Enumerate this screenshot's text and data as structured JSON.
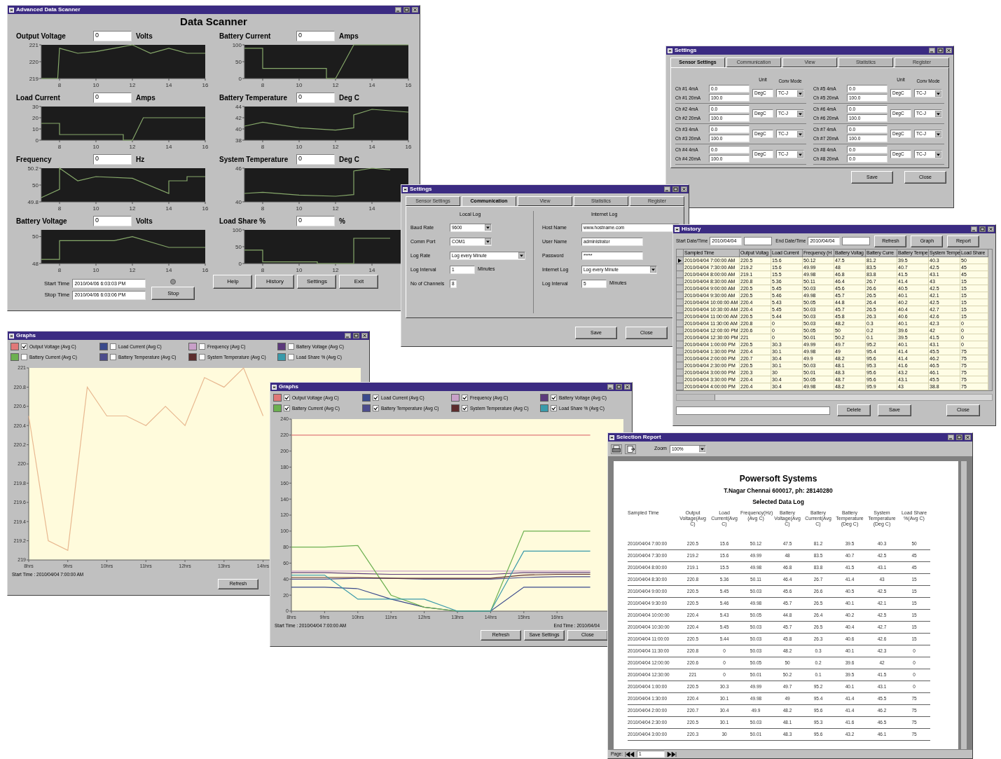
{
  "windows": [
    {
      "kind": "scanner",
      "title": "Advanced Data Scanner",
      "heading": "Data Scanner",
      "panels": [
        {
          "label": "Output Voltage",
          "value": "0",
          "unit": "Volts",
          "chart_data": {
            "type": "line",
            "x": [
              7,
              7.9,
              8,
              9,
              10,
              11,
              12,
              13,
              14,
              15,
              16
            ],
            "xlim": [
              7,
              16
            ],
            "ylim": [
              219,
              221
            ],
            "xticks": [
              8,
              10,
              12,
              14,
              16
            ],
            "yticks": [
              219,
              220,
              221
            ],
            "series": [
              {
                "color": "#86a86a",
                "values": [
                  219,
                  219,
                  220.8,
                  220.5,
                  220.6,
                  220.8,
                  221,
                  220.5,
                  220.8,
                  220.5,
                  220.5
                ]
              }
            ]
          }
        },
        {
          "label": "Battery Current",
          "value": "0",
          "unit": "Amps",
          "chart_data": {
            "type": "line",
            "x": [
              7,
              8,
              8,
              11.5,
              11.5,
              12,
              13,
              16
            ],
            "xlim": [
              7,
              16
            ],
            "ylim": [
              0,
              100
            ],
            "xticks": [
              8,
              10,
              12,
              14,
              16
            ],
            "yticks": [
              0,
              50,
              100
            ],
            "series": [
              {
                "color": "#86a86a",
                "values": [
                  90,
                  90,
                  30,
                  30,
                  0,
                  0,
                  100,
                  100
                ]
              }
            ]
          }
        },
        {
          "label": "Load Current",
          "value": "0",
          "unit": "Amps",
          "chart_data": {
            "type": "line",
            "x": [
              7,
              8,
              8,
              11.5,
              11.5,
              12,
              12.6,
              16
            ],
            "xlim": [
              7,
              16
            ],
            "ylim": [
              0,
              30
            ],
            "xticks": [
              8,
              10,
              12,
              14,
              16
            ],
            "yticks": [
              0,
              10,
              20,
              30
            ],
            "series": [
              {
                "color": "#86a86a",
                "values": [
                  15,
                  15,
                  5,
                  5,
                  0,
                  0,
                  20,
                  20
                ]
              }
            ]
          }
        },
        {
          "label": "Battery Temperature",
          "value": "0",
          "unit": "Deg C",
          "chart_data": {
            "type": "line",
            "x": [
              7,
              8,
              10,
              12,
              13,
              13,
              14,
              16
            ],
            "xlim": [
              7,
              16
            ],
            "ylim": [
              38,
              44
            ],
            "xticks": [
              8,
              10,
              12,
              14,
              16
            ],
            "yticks": [
              38,
              40,
              42,
              44
            ],
            "series": [
              {
                "color": "#86a86a",
                "values": [
                  40.5,
                  41.2,
                  40.2,
                  39.8,
                  40.2,
                  42.5,
                  43.5,
                  43
                ]
              }
            ]
          }
        },
        {
          "label": "Frequency",
          "value": "0",
          "unit": "Hz",
          "chart_data": {
            "type": "line",
            "x": [
              7,
              8,
              8,
              9,
              10,
              12,
              14,
              14,
              15,
              15,
              16
            ],
            "xlim": [
              7,
              16
            ],
            "ylim": [
              49.8,
              50.2
            ],
            "xticks": [
              8,
              10,
              12,
              14,
              16
            ],
            "yticks": [
              49.8,
              50,
              50.2
            ],
            "series": [
              {
                "color": "#86a86a",
                "values": [
                  49.85,
                  49.95,
                  50.2,
                  50.05,
                  50.1,
                  50.08,
                  49.9,
                  50.05,
                  50.05,
                  50.1,
                  50.1
                ]
              }
            ]
          }
        },
        {
          "label": "System Temperature",
          "value": "0",
          "unit": "Deg C",
          "chart_data": {
            "type": "line",
            "x": [
              7,
              8,
              10,
              12,
              13,
              13,
              14,
              15
            ],
            "xlim": [
              7,
              16
            ],
            "ylim": [
              40,
              46
            ],
            "xticks": [
              8,
              10,
              12,
              14
            ],
            "yticks": [
              40,
              46
            ],
            "series": [
              {
                "color": "#86a86a",
                "values": [
                  41.5,
                  41.7,
                  41.2,
                  41,
                  41.3,
                  45.5,
                  46,
                  45.7
                ]
              }
            ]
          }
        },
        {
          "label": "Battery Voltage",
          "value": "0",
          "unit": "Volts",
          "chart_data": {
            "type": "line",
            "x": [
              7,
              8,
              8,
              11,
              12,
              14,
              16
            ],
            "xlim": [
              7,
              16
            ],
            "ylim": [
              48,
              50.5
            ],
            "xticks": [
              8,
              10,
              12,
              14,
              16
            ],
            "yticks": [
              48,
              50
            ],
            "series": [
              {
                "color": "#86a86a",
                "values": [
                  48.3,
                  48.3,
                  49.7,
                  49.7,
                  50,
                  49.2,
                  49.2
                ]
              }
            ]
          }
        },
        {
          "label": "Load Share %",
          "value": "0",
          "unit": "%",
          "chart_data": {
            "type": "line",
            "x": [
              7,
              8,
              8,
              11,
              11,
              13,
              13,
              15
            ],
            "xlim": [
              7,
              16
            ],
            "ylim": [
              0,
              100
            ],
            "xticks": [
              8,
              10,
              12,
              14
            ],
            "yticks": [
              0,
              50,
              100
            ],
            "series": [
              {
                "color": "#86a86a",
                "values": [
                  40,
                  40,
                  5,
                  5,
                  0,
                  0,
                  75,
                  75
                ]
              }
            ]
          }
        }
      ],
      "start_label": "Start Time",
      "start_time": "2010/04/06 6:03:03 PM",
      "stop_label": "Stop Time",
      "stop_time": "2010/04/06 6:03:06 PM",
      "stop_button": "Stop",
      "buttons": [
        "Help",
        "History",
        "Settings",
        "Exit"
      ]
    },
    {
      "kind": "sensor_settings",
      "title": "Settings",
      "tabs": [
        {
          "label": "Sensor Settings",
          "selected": true
        },
        {
          "label": "Communication",
          "selected": false
        },
        {
          "label": "View",
          "selected": false
        },
        {
          "label": "Statistics",
          "selected": false
        },
        {
          "label": "Register",
          "selected": false
        }
      ],
      "column_headers": [
        {
          "unit": "Unit",
          "mode": "Conv Mode"
        },
        {
          "unit": "Unit",
          "mode": "Conv Mode"
        }
      ],
      "channels": [
        {
          "low_label": "Ch #1 4mA",
          "low": "0.0",
          "high_label": "Ch #1 20mA",
          "high": "100.0",
          "unit": "DegC",
          "mode": "TC-J"
        },
        {
          "low_label": "Ch #2 4mA",
          "low": "0.0",
          "high_label": "Ch #2 20mA",
          "high": "100.0",
          "unit": "DegC",
          "mode": "TC-J"
        },
        {
          "low_label": "Ch #3 4mA",
          "low": "0.0",
          "high_label": "Ch #3 20mA",
          "high": "100.0",
          "unit": "DegC",
          "mode": "TC-J"
        },
        {
          "low_label": "Ch #4 4mA",
          "low": "0.0",
          "high_label": "Ch #4 20mA",
          "high": "100.0",
          "unit": "DegC",
          "mode": "TC-J"
        },
        {
          "low_label": "Ch #5 4mA",
          "low": "0.0",
          "high_label": "Ch #5 20mA",
          "high": "100.0",
          "unit": "DegC",
          "mode": "TC-J"
        },
        {
          "low_label": "Ch #6 4mA",
          "low": "0.0",
          "high_label": "Ch #6 20mA",
          "high": "100.0",
          "unit": "DegC",
          "mode": "TC-J"
        },
        {
          "low_label": "Ch #7 4mA",
          "low": "0.0",
          "high_label": "Ch #7 20mA",
          "high": "100.0",
          "unit": "DegC",
          "mode": "TC-J"
        },
        {
          "low_label": "Ch #8 4mA",
          "low": "0.0",
          "high_label": "Ch #8 20mA",
          "high": "0.0",
          "unit": "DegC",
          "mode": "TC-J"
        }
      ],
      "buttons": [
        "Save",
        "Close"
      ]
    },
    {
      "kind": "communication_settings",
      "title": "Settings",
      "tabs": [
        {
          "label": "Sensor Settings",
          "selected": false
        },
        {
          "label": "Communication",
          "selected": true
        },
        {
          "label": "View",
          "selected": false
        },
        {
          "label": "Statistics",
          "selected": false
        },
        {
          "label": "Register",
          "selected": false
        }
      ],
      "groups": [
        {
          "heading": "Local Log",
          "fields": [
            {
              "kind": "select",
              "label": "Baud Rate",
              "value": "9600"
            },
            {
              "kind": "select",
              "label": "Comm Port",
              "value": "COM1"
            },
            {
              "kind": "wide_select",
              "label": "Log Rate",
              "value": "Log every Minute"
            },
            {
              "kind": "text",
              "label": "Log Interval",
              "value": "1",
              "unit": "Minutes"
            },
            {
              "kind": "small",
              "label": "No of Channels",
              "value": "8"
            }
          ]
        },
        {
          "heading": "Internet Log",
          "fields": [
            {
              "kind": "wide_text",
              "label": "Host Name",
              "value": "www.hostname.com"
            },
            {
              "kind": "text_medium",
              "label": "User Name",
              "value": "administrator"
            },
            {
              "kind": "text_medium",
              "label": "Password",
              "value": "*****"
            },
            {
              "kind": "wide_select",
              "label": "Internet Log",
              "value": "Log every Minute"
            },
            {
              "kind": "text",
              "label": "Log Interval",
              "value": "5",
              "unit": "Minutes"
            }
          ]
        }
      ],
      "buttons": [
        "Save",
        "Close"
      ]
    },
    {
      "kind": "history",
      "title": "History",
      "start_label": "Start Date/Time",
      "start_date": "2010/04/04",
      "end_label": "End Date/Time",
      "end_date": "2010/04/04",
      "top_buttons": [
        "Refresh",
        "Graph",
        "Report"
      ],
      "columns": [
        "Sampled Time",
        "Output Voltag",
        "Load Current",
        "Frequency (H",
        "Battery Voltag",
        "Battery Curre",
        "Battery Tempe",
        "System Tempe",
        "Load Share"
      ],
      "rows": [
        {
          "selected": true,
          "cells": [
            "2010/04/04 7:00:00 AM",
            "220.5",
            "15.6",
            "50.12",
            "47.5",
            "81.2",
            "39.5",
            "40.3",
            "50"
          ]
        },
        {
          "selected": false,
          "cells": [
            "2010/04/04 7:30:00 AM",
            "219.2",
            "15.6",
            "49.99",
            "48",
            "83.5",
            "40.7",
            "42.5",
            "45"
          ]
        },
        {
          "selected": false,
          "cells": [
            "2010/04/04 8:00:00 AM",
            "219.1",
            "15.5",
            "49.98",
            "46.8",
            "83.8",
            "41.5",
            "43.1",
            "45"
          ]
        },
        {
          "selected": false,
          "cells": [
            "2010/04/04 8:30:00 AM",
            "220.8",
            "5.36",
            "50.11",
            "46.4",
            "26.7",
            "41.4",
            "43",
            "15"
          ]
        },
        {
          "selected": false,
          "cells": [
            "2010/04/04 9:00:00 AM",
            "220.5",
            "5.45",
            "50.03",
            "45.6",
            "26.6",
            "40.5",
            "42.5",
            "15"
          ]
        },
        {
          "selected": false,
          "cells": [
            "2010/04/04 9:30:00 AM",
            "220.5",
            "5.46",
            "49.98",
            "45.7",
            "26.5",
            "40.1",
            "42.1",
            "15"
          ]
        },
        {
          "selected": false,
          "cells": [
            "2010/04/04 10:00:00 AM",
            "220.4",
            "5.43",
            "50.05",
            "44.8",
            "26.4",
            "40.2",
            "42.5",
            "15"
          ]
        },
        {
          "selected": false,
          "cells": [
            "2010/04/04 10:30:00 AM",
            "220.4",
            "5.45",
            "50.03",
            "45.7",
            "26.5",
            "40.4",
            "42.7",
            "15"
          ]
        },
        {
          "selected": false,
          "cells": [
            "2010/04/04 11:00:00 AM",
            "220.5",
            "5.44",
            "50.03",
            "45.8",
            "26.3",
            "40.6",
            "42.6",
            "15"
          ]
        },
        {
          "selected": false,
          "cells": [
            "2010/04/04 11:30:00 AM",
            "220.8",
            "0",
            "50.03",
            "48.2",
            "0.3",
            "40.1",
            "42.3",
            "0"
          ]
        },
        {
          "selected": false,
          "cells": [
            "2010/04/04 12:00:00 PM",
            "220.6",
            "0",
            "50.05",
            "50",
            "0.2",
            "39.6",
            "42",
            "0"
          ]
        },
        {
          "selected": false,
          "cells": [
            "2010/04/04 12:30:00 PM",
            "221",
            "0",
            "50.01",
            "50.2",
            "0.1",
            "39.5",
            "41.5",
            "0"
          ]
        },
        {
          "selected": false,
          "cells": [
            "2010/04/04 1:00:00 PM",
            "220.5",
            "30.3",
            "49.99",
            "49.7",
            "95.2",
            "40.1",
            "43.1",
            "0"
          ]
        },
        {
          "selected": false,
          "cells": [
            "2010/04/04 1:30:00 PM",
            "220.4",
            "30.1",
            "49.98",
            "49",
            "95.4",
            "41.4",
            "45.5",
            "75"
          ]
        },
        {
          "selected": false,
          "cells": [
            "2010/04/04 2:00:00 PM",
            "220.7",
            "30.4",
            "49.9",
            "48.2",
            "95.6",
            "41.4",
            "46.2",
            "75"
          ]
        },
        {
          "selected": false,
          "cells": [
            "2010/04/04 2:30:00 PM",
            "220.5",
            "30.1",
            "50.03",
            "48.1",
            "95.3",
            "41.6",
            "46.5",
            "75"
          ]
        },
        {
          "selected": false,
          "cells": [
            "2010/04/04 3:00:00 PM",
            "220.3",
            "30",
            "50.01",
            "48.3",
            "95.6",
            "43.2",
            "46.1",
            "75"
          ]
        },
        {
          "selected": false,
          "cells": [
            "2010/04/04 3:30:00 PM",
            "220.4",
            "30.4",
            "50.05",
            "48.7",
            "95.6",
            "43.1",
            "45.5",
            "75"
          ]
        },
        {
          "selected": false,
          "cells": [
            "2010/04/04 4:00:00 PM",
            "220.4",
            "30.4",
            "49.98",
            "48.2",
            "95.9",
            "43",
            "38.8",
            "75"
          ]
        }
      ],
      "bottom_buttons": [
        "Delete",
        "Save",
        "Close"
      ]
    },
    {
      "kind": "graphs",
      "title": "Graphs",
      "legend": [
        {
          "label": "Output Voltage (Avg C)",
          "color": "#e07878",
          "checked": true
        },
        {
          "label": "Load Current (Avg C)",
          "color": "#3a4a8c",
          "checked": false
        },
        {
          "label": "Frequency (Avg C)",
          "color": "#c8a0c8",
          "checked": false
        },
        {
          "label": "Battery Voltage (Avg C)",
          "color": "#5c3a7c",
          "checked": false
        },
        {
          "label": "Battery Current (Avg C)",
          "color": "#6cb050",
          "checked": false
        },
        {
          "label": "Battery Temperature (Avg C)",
          "color": "#4c4c8c",
          "checked": false
        },
        {
          "label": "System Temperature (Avg C)",
          "color": "#5c2c2c",
          "checked": false
        },
        {
          "label": "Load Share % (Avg C)",
          "color": "#3a9aaa",
          "checked": false
        }
      ],
      "chart_data": {
        "type": "line",
        "categories": [
          "8hrs",
          null,
          "9hrs",
          null,
          "10hrs",
          null,
          "11hrs",
          null,
          "12hrs",
          null,
          "13hrs",
          null,
          "14hrs",
          null,
          null,
          null,
          null,
          null
        ],
        "ylim": [
          219,
          221
        ],
        "yticks": [
          219,
          219.2,
          219.4,
          219.6,
          219.8,
          220,
          220.2,
          220.4,
          220.6,
          220.8,
          221
        ],
        "series": [
          {
            "color": "#e8b890",
            "values": [
              220.5,
              219.2,
              219.1,
              220.8,
              220.5,
              220.5,
              220.4,
              220.6,
              220.4,
              220.9,
              220.8,
              221,
              220.5,
              null,
              null,
              null,
              null,
              null
            ]
          }
        ]
      },
      "start_time": "Start Time : 2010/04/04 7:00:00 AM",
      "buttons": [
        "Refresh"
      ]
    },
    {
      "kind": "graphs",
      "title": "Graphs",
      "legend": [
        {
          "label": "Output Voltage (Avg C)",
          "color": "#e07878",
          "checked": true
        },
        {
          "label": "Load Current (Avg C)",
          "color": "#3a4a8c",
          "checked": true
        },
        {
          "label": "Frequency (Avg C)",
          "color": "#c8a0c8",
          "checked": true
        },
        {
          "label": "Battery Voltage (Avg C)",
          "color": "#5c3a7c",
          "checked": true
        },
        {
          "label": "Battery Current (Avg C)",
          "color": "#6cb050",
          "checked": true
        },
        {
          "label": "Battery Temperature (Avg C)",
          "color": "#4c4c8c",
          "checked": true
        },
        {
          "label": "System Temperature (Avg C)",
          "color": "#5c2c2c",
          "checked": true
        },
        {
          "label": "Load Share % (Avg C)",
          "color": "#3a9aaa",
          "checked": true
        }
      ],
      "chart_data": {
        "type": "line",
        "categories": [
          "8hrs",
          "9hrs",
          "10hrs",
          "11hrs",
          "12hrs",
          "13hrs",
          "14hrs",
          "15hrs",
          "16hrs",
          null,
          null
        ],
        "ylim": [
          0,
          240
        ],
        "yticks": [
          0,
          20,
          40,
          60,
          80,
          100,
          120,
          140,
          160,
          180,
          200,
          220,
          240
        ],
        "series": [
          {
            "color": "#e07878",
            "values": [
              220,
              220,
              220,
              220,
              220,
              220,
              220,
              220,
              220,
              220,
              null
            ]
          },
          {
            "color": "#3a4a8c",
            "values": [
              30,
              30,
              28,
              15,
              5,
              0,
              0,
              30,
              30,
              30,
              null
            ]
          },
          {
            "color": "#c8a0c8",
            "values": [
              50,
              50,
              50,
              50,
              50,
              50,
              50,
              50,
              50,
              50,
              null
            ]
          },
          {
            "color": "#5c3a7c",
            "values": [
              48,
              48,
              47,
              46,
              46,
              46,
              46,
              48,
              48,
              48,
              null
            ]
          },
          {
            "color": "#6cb050",
            "values": [
              80,
              80,
              82,
              20,
              5,
              0,
              0,
              100,
              100,
              100,
              null
            ]
          },
          {
            "color": "#4c4c8c",
            "values": [
              40,
              40,
              41,
              41,
              40,
              40,
              40,
              42,
              43,
              43,
              null
            ]
          },
          {
            "color": "#5c2c2c",
            "values": [
              42,
              42,
              42,
              41,
              41,
              41,
              41,
              45,
              46,
              46,
              null
            ]
          },
          {
            "color": "#3a9aaa",
            "values": [
              45,
              45,
              15,
              15,
              15,
              0,
              0,
              75,
              75,
              75,
              null
            ]
          }
        ]
      },
      "start_time": "Start Time : 2010/04/04 7:00:00 AM",
      "end_time": "End Time : 2010/04/04",
      "buttons": [
        "Refresh",
        "Save Settings",
        "Close"
      ]
    },
    {
      "kind": "report",
      "title": "Selection Report",
      "zoom_label": "Zoom",
      "zoom": "100%",
      "company": "Powersoft Systems",
      "address": "T.Nagar Chennai 600017, ph: 28140280",
      "heading": "Selected Data Log",
      "columns": [
        "Sampled Time",
        "Output Voltage(Avg C)",
        "Load Current(Avg C)",
        "Frequency(Hz)(Avg C)",
        "Battery Voltage(Avg C)",
        "Battery Current(Avg C)",
        "Battery Temperature (Deg C)",
        "System Temperature (Deg C)",
        "Load Share %(Avg C)"
      ],
      "rows": [
        [
          "2010/04/04 7:00:00",
          "220.5",
          "15.6",
          "50.12",
          "47.5",
          "81.2",
          "39.5",
          "40.3",
          "50"
        ],
        [
          "2010/04/04 7:30:00",
          "219.2",
          "15.6",
          "49.99",
          "48",
          "83.5",
          "40.7",
          "42.5",
          "45"
        ],
        [
          "2010/04/04 8:00:00",
          "219.1",
          "15.5",
          "49.98",
          "46.8",
          "83.8",
          "41.5",
          "43.1",
          "45"
        ],
        [
          "2010/04/04 8:30:00",
          "220.8",
          "5.36",
          "50.11",
          "46.4",
          "26.7",
          "41.4",
          "43",
          "15"
        ],
        [
          "2010/04/04 9:00:00",
          "220.5",
          "5.45",
          "50.03",
          "45.6",
          "26.6",
          "40.5",
          "42.5",
          "15"
        ],
        [
          "2010/04/04 9:30:00",
          "220.5",
          "5.46",
          "49.98",
          "45.7",
          "26.5",
          "40.1",
          "42.1",
          "15"
        ],
        [
          "2010/04/04 10:00:00",
          "220.4",
          "5.43",
          "50.05",
          "44.8",
          "26.4",
          "40.2",
          "42.5",
          "15"
        ],
        [
          "2010/04/04 10:30:00",
          "220.4",
          "5.45",
          "50.03",
          "45.7",
          "26.5",
          "40.4",
          "42.7",
          "15"
        ],
        [
          "2010/04/04 11:00:00",
          "220.5",
          "5.44",
          "50.03",
          "45.8",
          "26.3",
          "40.6",
          "42.6",
          "15"
        ],
        [
          "2010/04/04 11:30:00",
          "220.8",
          "0",
          "50.03",
          "48.2",
          "0.3",
          "40.1",
          "42.3",
          "0"
        ],
        [
          "2010/04/04 12:00:00",
          "220.6",
          "0",
          "50.05",
          "50",
          "0.2",
          "39.6",
          "42",
          "0"
        ],
        [
          "2010/04/04 12:30:00",
          "221",
          "0",
          "50.01",
          "50.2",
          "0.1",
          "39.5",
          "41.5",
          "0"
        ],
        [
          "2010/04/04 1:00:00",
          "220.5",
          "30.3",
          "49.99",
          "49.7",
          "95.2",
          "40.1",
          "43.1",
          "0"
        ],
        [
          "2010/04/04 1:30:00",
          "220.4",
          "30.1",
          "49.98",
          "49",
          "95.4",
          "41.4",
          "45.5",
          "75"
        ],
        [
          "2010/04/04 2:00:00",
          "220.7",
          "30.4",
          "49.9",
          "48.2",
          "95.6",
          "41.4",
          "46.2",
          "75"
        ],
        [
          "2010/04/04 2:30:00",
          "220.5",
          "30.1",
          "50.03",
          "48.1",
          "95.3",
          "41.6",
          "46.5",
          "75"
        ],
        [
          "2010/04/04 3:00:00",
          "220.3",
          "30",
          "50.01",
          "48.3",
          "95.6",
          "43.2",
          "46.1",
          "75"
        ]
      ],
      "page_label": "Page:",
      "page": "1"
    }
  ]
}
